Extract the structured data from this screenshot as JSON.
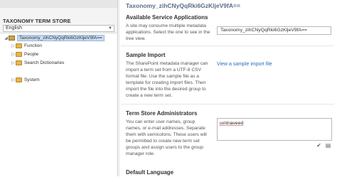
{
  "left_panel": {
    "title": "TAXONOMY TERM STORE",
    "language": {
      "selected": "English"
    },
    "tree": [
      {
        "label": "Taxonomy_zihCNyQqRki6GzKljeV9fA==",
        "selected": true,
        "icon": "term-store-icon"
      },
      {
        "label": "Function",
        "icon": "folder-icon"
      },
      {
        "label": "People",
        "icon": "folder-icon"
      },
      {
        "label": "Search Dictionaries",
        "icon": "folder-icon"
      },
      {
        "label": "System",
        "icon": "folder-icon"
      }
    ]
  },
  "right_panel": {
    "title": "Taxonomy_zihCNyQqRki6GzKljeV9fA==",
    "service_apps": {
      "heading": "Available Service Applications",
      "text": "A site may consume multiple metadata applications. Select the one to see in the tree view.",
      "select_value": "Taxonomy_zihCNyQqRki6GzKljeV9fA=="
    },
    "sample_import": {
      "heading": "Sample Import",
      "text": "The SharePoint metadata manager can import a term set from a UTF-8 CSV format file. Use the sample file as a template for creating import files. Then import the file into the desired group to create a new term set.",
      "link": "View a sample import file"
    },
    "admins": {
      "heading": "Term Store Administrators",
      "text": "You can enter user names, group names, or e-mail addresses. Separate them with semicolons. These users will be permitted to create new term set groups and assign users to the group manager role.",
      "value": "us\\tnaveed"
    },
    "default_language": {
      "heading": "Default Language"
    }
  }
}
